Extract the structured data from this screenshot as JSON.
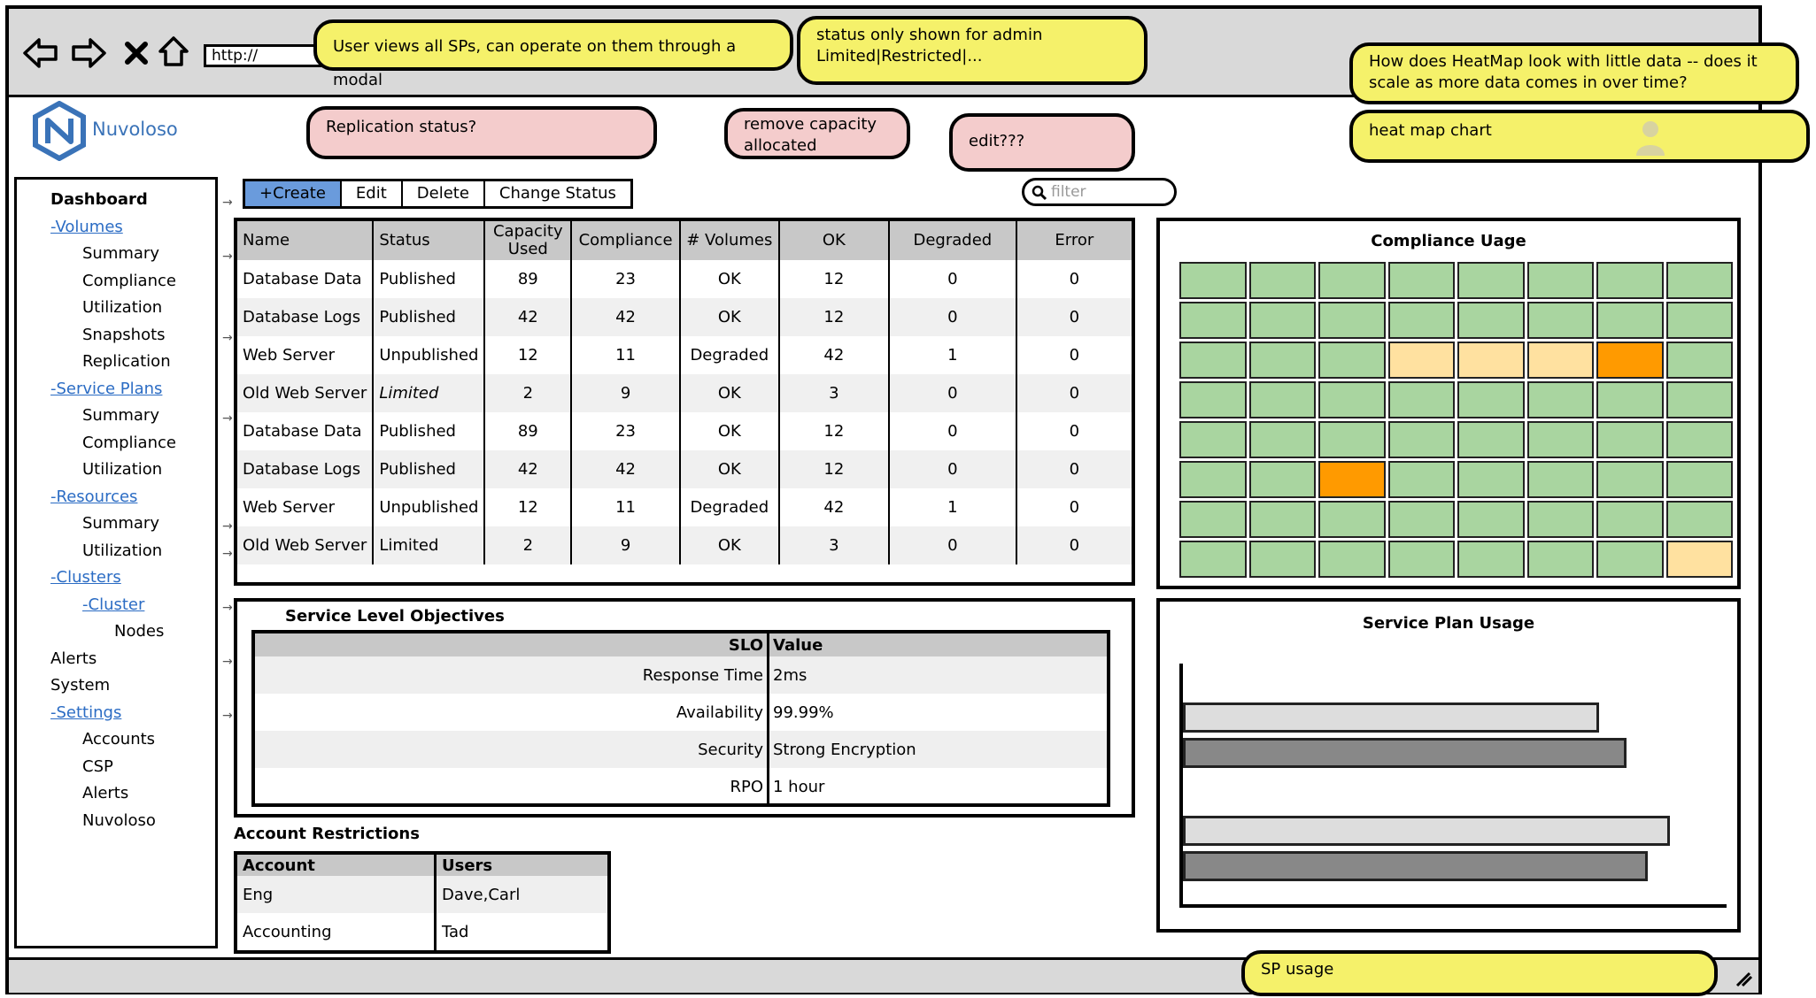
{
  "browser": {
    "url": "http://",
    "icons": [
      "back-arrow-icon",
      "forward-arrow-icon",
      "close-icon",
      "home-icon"
    ]
  },
  "annotations": {
    "sp_modal": "User views all SPs, can operate on them through a modal",
    "status_admin_line1": "status only shown for admin",
    "status_admin_line2": "Limited|Restricted|...",
    "heatmap_scale": "How does HeatMap look with little data -- does it scale as more data comes in over time?",
    "replication": "Replication status?",
    "remove_capacity": "remove capacity allocated",
    "edit": "edit???",
    "heatmap_chart": "heat map chart",
    "sp_usage": "SP usage"
  },
  "brand": {
    "name": "Nuvoloso",
    "accent": "#3a73b8"
  },
  "sidebar": {
    "items": [
      {
        "label": "Dashboard",
        "style": "bold",
        "indent": 0
      },
      {
        "label": "-Volumes",
        "style": "link",
        "indent": 0
      },
      {
        "label": "Summary",
        "style": "plain",
        "indent": 1
      },
      {
        "label": "Compliance",
        "style": "plain",
        "indent": 1
      },
      {
        "label": "Utilization",
        "style": "plain",
        "indent": 1
      },
      {
        "label": "Snapshots",
        "style": "plain",
        "indent": 1
      },
      {
        "label": "Replication",
        "style": "plain",
        "indent": 1
      },
      {
        "label": "-Service Plans",
        "style": "link",
        "indent": 0
      },
      {
        "label": "Summary",
        "style": "plain",
        "indent": 1
      },
      {
        "label": "Compliance",
        "style": "plain",
        "indent": 1
      },
      {
        "label": "Utilization",
        "style": "plain",
        "indent": 1
      },
      {
        "label": "-Resources",
        "style": "link",
        "indent": 0
      },
      {
        "label": "Summary",
        "style": "plain",
        "indent": 1
      },
      {
        "label": "Utilization",
        "style": "plain",
        "indent": 1
      },
      {
        "label": "-Clusters",
        "style": "link",
        "indent": 0
      },
      {
        "label": "-Cluster",
        "style": "link",
        "indent": 1
      },
      {
        "label": "Nodes",
        "style": "plain",
        "indent": 2
      },
      {
        "label": "Alerts",
        "style": "plain",
        "indent": 0
      },
      {
        "label": "System",
        "style": "plain",
        "indent": 0
      },
      {
        "label": "-Settings",
        "style": "link",
        "indent": 0
      },
      {
        "label": "Accounts",
        "style": "plain",
        "indent": 1
      },
      {
        "label": "CSP",
        "style": "plain",
        "indent": 1
      },
      {
        "label": "Alerts",
        "style": "plain",
        "indent": 1
      },
      {
        "label": "Nuvoloso",
        "style": "plain",
        "indent": 1
      }
    ]
  },
  "toolbar": {
    "create": "+Create",
    "edit": "Edit",
    "delete": "Delete",
    "change_status": "Change Status",
    "filter_placeholder": "filter"
  },
  "sp_table": {
    "headers": [
      "Name",
      "Status",
      "Capacity Used",
      "Compliance",
      "# Volumes",
      "OK",
      "Degraded",
      "Error"
    ],
    "rows": [
      [
        "Database Data",
        "Published",
        "89",
        "23",
        "OK",
        "12",
        "0",
        "0"
      ],
      [
        "Database Logs",
        "Published",
        "42",
        "42",
        "OK",
        "12",
        "0",
        "0"
      ],
      [
        "Web Server",
        "Unpublished",
        "12",
        "11",
        "Degraded",
        "42",
        "1",
        "0"
      ],
      [
        "Old Web Server",
        "Limited",
        "2",
        "9",
        "OK",
        "3",
        "0",
        "0"
      ],
      [
        "Database Data",
        "Published",
        "89",
        "23",
        "OK",
        "12",
        "0",
        "0"
      ],
      [
        "Database Logs",
        "Published",
        "42",
        "42",
        "OK",
        "12",
        "0",
        "0"
      ],
      [
        "Web Server",
        "Unpublished",
        "12",
        "11",
        "Degraded",
        "42",
        "1",
        "0"
      ],
      [
        "Old Web Server",
        "Limited",
        "2",
        "9",
        "OK",
        "3",
        "0",
        "0"
      ]
    ],
    "italic_rows": [
      3
    ]
  },
  "slo": {
    "title": "Service Level Objectives",
    "headers": [
      "SLO",
      "Value"
    ],
    "rows": [
      [
        "Response Time",
        "2ms"
      ],
      [
        "Availability",
        "99.99%"
      ],
      [
        "Security",
        "Strong Encryption"
      ],
      [
        "RPO",
        "1 hour"
      ]
    ]
  },
  "account_restrictions": {
    "title": "Account Restrictions",
    "headers": [
      "Account",
      "Users"
    ],
    "rows": [
      [
        "Eng",
        "Dave,Carl"
      ],
      [
        "Accounting",
        "Tad"
      ]
    ]
  },
  "heatmap": {
    "title": "Compliance Uage",
    "rows": 8,
    "cols": 8,
    "colors": {
      "ok": "#a9d5a0",
      "warn": "#ffe1a0",
      "bad": "#ff9a00"
    },
    "cells": [
      [
        "ok",
        "ok",
        "ok",
        "ok",
        "ok",
        "ok",
        "ok",
        "ok"
      ],
      [
        "ok",
        "ok",
        "ok",
        "ok",
        "ok",
        "ok",
        "ok",
        "ok"
      ],
      [
        "ok",
        "ok",
        "ok",
        "warn",
        "warn",
        "warn",
        "bad",
        "ok"
      ],
      [
        "ok",
        "ok",
        "ok",
        "ok",
        "ok",
        "ok",
        "ok",
        "ok"
      ],
      [
        "ok",
        "ok",
        "ok",
        "ok",
        "ok",
        "ok",
        "ok",
        "ok"
      ],
      [
        "ok",
        "ok",
        "bad",
        "ok",
        "ok",
        "ok",
        "ok",
        "ok"
      ],
      [
        "ok",
        "ok",
        "ok",
        "ok",
        "ok",
        "ok",
        "ok",
        "ok"
      ],
      [
        "ok",
        "ok",
        "ok",
        "ok",
        "ok",
        "ok",
        "ok",
        "warn"
      ]
    ]
  },
  "sp_usage_chart": {
    "title": "Service Plan Usage",
    "bars": [
      {
        "value": 0.76,
        "color": "#dddddd"
      },
      {
        "value": 0.81,
        "color": "#888888"
      },
      {
        "value": 0.89,
        "color": "#dddddd"
      },
      {
        "value": 0.85,
        "color": "#888888"
      }
    ]
  }
}
